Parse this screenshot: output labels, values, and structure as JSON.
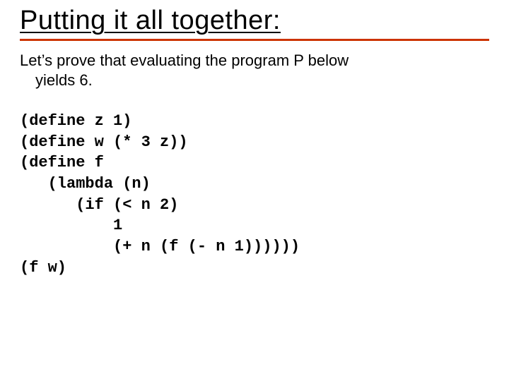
{
  "title": "Putting it all together:",
  "intro_line1": "Let’s prove that evaluating the program P below",
  "intro_line2": "yields 6.",
  "code": "(define z 1)\n(define w (* 3 z))\n(define f\n   (lambda (n)\n      (if (< n 2)\n          1\n          (+ n (f (- n 1))))))\n(f w)"
}
